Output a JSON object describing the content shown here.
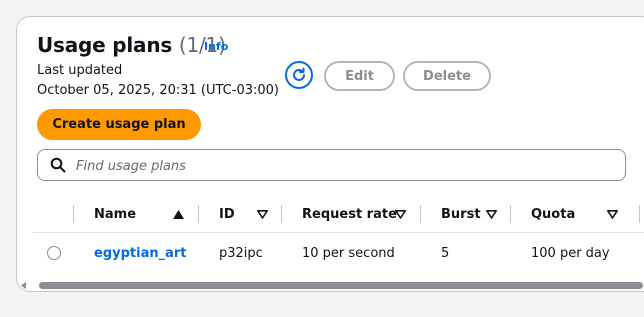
{
  "header": {
    "title": "Usage plans",
    "count": "(1/1)",
    "info_link": "Info",
    "last_updated_label": "Last updated",
    "last_updated_value": "October 05, 2025, 20:31 (UTC-03:00)"
  },
  "actions": {
    "refresh_icon": "refresh-icon",
    "edit_label": "Edit",
    "delete_label": "Delete",
    "create_label": "Create usage plan"
  },
  "search": {
    "placeholder": "Find usage plans",
    "value": ""
  },
  "table": {
    "columns": [
      {
        "label": "Name",
        "sort": "ascending"
      },
      {
        "label": "ID",
        "sort": "none"
      },
      {
        "label": "Request rate",
        "sort": "none"
      },
      {
        "label": "Burst",
        "sort": "none"
      },
      {
        "label": "Quota",
        "sort": "none"
      }
    ],
    "rows": [
      {
        "name": "egyptian_art",
        "id": "p32ipc",
        "request_rate": "10 per second",
        "burst": "5",
        "quota": "100 per day"
      }
    ]
  },
  "colors": {
    "accent": "#006ce0",
    "primary_button": "#ff9900",
    "disabled": "#8c8c94"
  }
}
